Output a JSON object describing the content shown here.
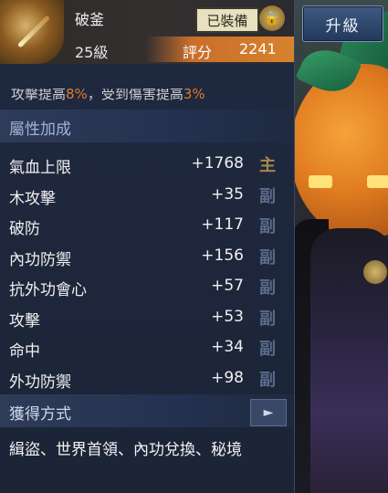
{
  "upgrade_label": "升級",
  "item": {
    "name": "破釜",
    "level": "25級",
    "equipped": "已裝備",
    "score_label": "評分",
    "score_value": "2241",
    "description_parts": [
      "攻擊提高",
      "8%",
      "，受到傷害提高",
      "3%"
    ]
  },
  "attributes": {
    "title": "屬性加成",
    "rows": [
      {
        "name": "氣血上限",
        "value": "+1768",
        "tag": "主"
      },
      {
        "name": "木攻擊",
        "value": "+35",
        "tag": "副"
      },
      {
        "name": "破防",
        "value": "+117",
        "tag": "副"
      },
      {
        "name": "內功防禦",
        "value": "+156",
        "tag": "副"
      },
      {
        "name": "抗外功會心",
        "value": "+57",
        "tag": "副"
      },
      {
        "name": "攻擊",
        "value": "+53",
        "tag": "副"
      },
      {
        "name": "命中",
        "value": "+34",
        "tag": "副"
      },
      {
        "name": "外功防禦",
        "value": "+98",
        "tag": "副"
      }
    ]
  },
  "acquisition": {
    "title": "獲得方式",
    "sources": "緝盜、世界首領、內功兌換、秘境"
  },
  "colors": {
    "score_bar": "#d7822f",
    "highlight": "#e07b2a",
    "main_tag": "#a68a4a",
    "sub_tag": "#5a6b8a"
  }
}
